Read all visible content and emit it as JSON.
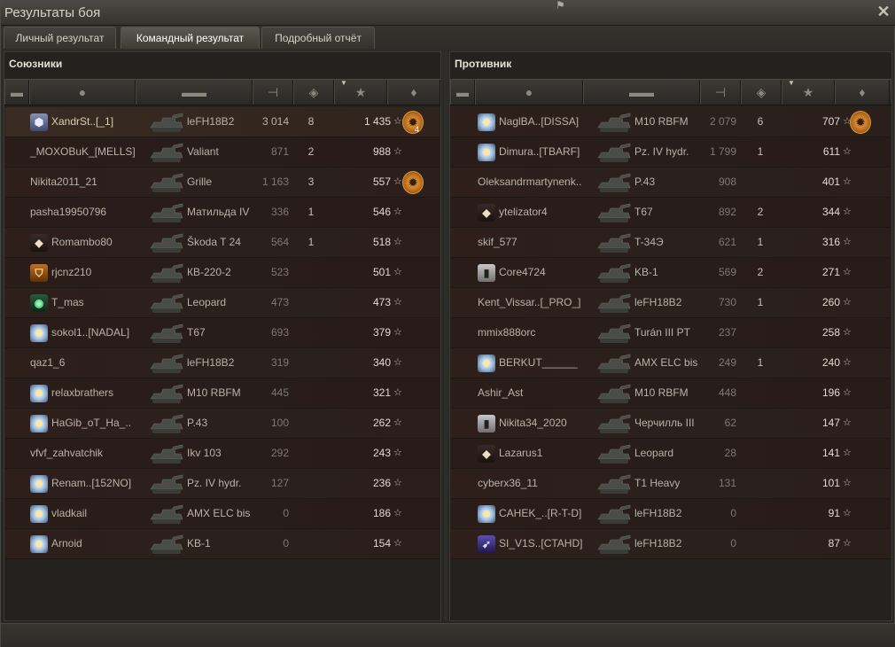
{
  "window": {
    "title": "Результаты боя",
    "close_glyph": "✕"
  },
  "tabs": [
    {
      "label": "Личный результат",
      "active": false
    },
    {
      "label": "Командный результат",
      "active": true
    },
    {
      "label": "Подробный отчёт",
      "active": false
    }
  ],
  "headers": {
    "columns": [
      "platoon-icon",
      "player-icon",
      "tank-icon",
      "damage-icon",
      "kills-icon",
      "xp-star-icon",
      "medal-icon"
    ]
  },
  "allies": {
    "title": "Союзники",
    "rows": [
      {
        "name": "XandrSt..[_1]",
        "vehicle": "leFH18B2",
        "damage": "3 014",
        "kills": "8",
        "xp": "1 435",
        "emblem": "hex",
        "medal": true,
        "medal_count": "4",
        "me": true
      },
      {
        "name": "_MOXOBuK_[MELLS]",
        "vehicle": "Valiant",
        "damage": "871",
        "kills": "2",
        "xp": "988",
        "emblem": "",
        "medal": false
      },
      {
        "name": "Nikita2011_21",
        "vehicle": "Grille",
        "damage": "1 163",
        "kills": "3",
        "xp": "557",
        "emblem": "",
        "medal": true
      },
      {
        "name": "pasha19950796",
        "vehicle": "Матильда IV",
        "damage": "336",
        "kills": "1",
        "xp": "546",
        "emblem": "",
        "medal": false
      },
      {
        "name": "Romambo80",
        "vehicle": "Škoda T 24",
        "damage": "564",
        "kills": "1",
        "xp": "518",
        "emblem": "diamond",
        "medal": false
      },
      {
        "name": "rjcnz210",
        "vehicle": "КВ-220-2",
        "damage": "523",
        "kills": "",
        "xp": "501",
        "emblem": "shield",
        "medal": false
      },
      {
        "name": "T_mas",
        "vehicle": "Leopard",
        "damage": "473",
        "kills": "",
        "xp": "473",
        "emblem": "green",
        "medal": false
      },
      {
        "name": "sokol1..[NADAL]",
        "vehicle": "T67",
        "damage": "693",
        "kills": "",
        "xp": "379",
        "emblem": "star",
        "medal": false
      },
      {
        "name": "qaz1_6",
        "vehicle": "leFH18B2",
        "damage": "319",
        "kills": "",
        "xp": "340",
        "emblem": "",
        "medal": false
      },
      {
        "name": "relaxbrathers",
        "vehicle": "M10 RBFM",
        "damage": "445",
        "kills": "",
        "xp": "321",
        "emblem": "star",
        "medal": false
      },
      {
        "name": "HaGib_oT_Ha_..",
        "vehicle": "P.43",
        "damage": "100",
        "kills": "",
        "xp": "262",
        "emblem": "star",
        "medal": false
      },
      {
        "name": "vfvf_zahvatchik",
        "vehicle": "Ikv 103",
        "damage": "292",
        "kills": "",
        "xp": "243",
        "emblem": "",
        "medal": false
      },
      {
        "name": "Renam..[152NO]",
        "vehicle": "Pz. IV hydr.",
        "damage": "127",
        "kills": "",
        "xp": "236",
        "emblem": "star",
        "medal": false
      },
      {
        "name": "vladkail",
        "vehicle": "AMX ELC bis",
        "damage": "0",
        "kills": "",
        "xp": "186",
        "emblem": "star",
        "medal": false
      },
      {
        "name": "Arnoid",
        "vehicle": "KB-1",
        "damage": "0",
        "kills": "",
        "xp": "154",
        "emblem": "star",
        "medal": false
      }
    ]
  },
  "enemies": {
    "title": "Противник",
    "rows": [
      {
        "name": "NaglBA..[DISSA]",
        "vehicle": "M10 RBFM",
        "damage": "2 079",
        "kills": "6",
        "xp": "707",
        "emblem": "star",
        "medal": true
      },
      {
        "name": "Dimura..[TBARF]",
        "vehicle": "Pz. IV hydr.",
        "damage": "1 799",
        "kills": "1",
        "xp": "611",
        "emblem": "star",
        "medal": false
      },
      {
        "name": "Oleksandrmartynenk..",
        "vehicle": "P.43",
        "damage": "908",
        "kills": "",
        "xp": "401",
        "emblem": "",
        "medal": false
      },
      {
        "name": "ytelizator4",
        "vehicle": "T67",
        "damage": "892",
        "kills": "2",
        "xp": "344",
        "emblem": "diamond",
        "medal": false
      },
      {
        "name": "skif_577",
        "vehicle": "T-34Э",
        "damage": "621",
        "kills": "1",
        "xp": "316",
        "emblem": "",
        "medal": false
      },
      {
        "name": "Core4724",
        "vehicle": "KB-1",
        "damage": "569",
        "kills": "2",
        "xp": "271",
        "emblem": "plain",
        "medal": false
      },
      {
        "name": "Kent_Vissar..[_PRO_]",
        "vehicle": "leFH18B2",
        "damage": "730",
        "kills": "1",
        "xp": "260",
        "emblem": "",
        "medal": false
      },
      {
        "name": "mmix888orc",
        "vehicle": "Turán III PT",
        "damage": "237",
        "kills": "",
        "xp": "258",
        "emblem": "",
        "medal": false
      },
      {
        "name": "BERKUT______",
        "vehicle": "AMX ELC bis",
        "damage": "249",
        "kills": "1",
        "xp": "240",
        "emblem": "star",
        "medal": false
      },
      {
        "name": "Ashir_Ast",
        "vehicle": "M10 RBFM",
        "damage": "448",
        "kills": "",
        "xp": "196",
        "emblem": "",
        "medal": false
      },
      {
        "name": "Nikita34_2020",
        "vehicle": "Черчилль III",
        "damage": "62",
        "kills": "",
        "xp": "147",
        "emblem": "plain",
        "medal": false
      },
      {
        "name": "Lazarus1",
        "vehicle": "Leopard",
        "damage": "28",
        "kills": "",
        "xp": "141",
        "emblem": "diamond",
        "medal": false
      },
      {
        "name": "cyberx36_11",
        "vehicle": "T1 Heavy",
        "damage": "131",
        "kills": "",
        "xp": "101",
        "emblem": "",
        "medal": false
      },
      {
        "name": "CAHEK_..[R-T-D]",
        "vehicle": "leFH18B2",
        "damage": "0",
        "kills": "",
        "xp": "91",
        "emblem": "star",
        "medal": false
      },
      {
        "name": "SI_V1S..[CTAHD]",
        "vehicle": "leFH18B2",
        "damage": "0",
        "kills": "",
        "xp": "87",
        "emblem": "purple",
        "medal": false
      }
    ]
  },
  "colors": {
    "accent": "#e0b060",
    "bg": "#23221e",
    "row": "#2e1f1b"
  }
}
